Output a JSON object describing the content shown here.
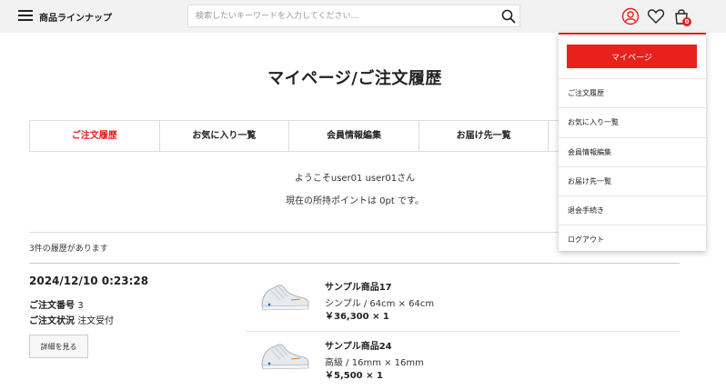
{
  "header": {
    "menu_label": "商品ラインナップ",
    "search_placeholder": "検索したいキーワードを入力してください...",
    "cart_count": "0",
    "accent": "#e8211c"
  },
  "icons": [
    "hamburger-icon",
    "search-icon",
    "user-icon",
    "heart-icon",
    "cart-icon"
  ],
  "page": {
    "title": "マイページ/ご注文履歴",
    "tabs": [
      {
        "label": "ご注文履歴",
        "active": true
      },
      {
        "label": "お気に入り一覧",
        "active": false
      },
      {
        "label": "会員情報編集",
        "active": false
      },
      {
        "label": "お届け先一覧",
        "active": false
      }
    ],
    "welcome": "ようこそuser01 user01さん",
    "points": "現在の所持ポイントは 0pt です。",
    "history_count": "3件の履歴があります"
  },
  "order": {
    "date": "2024/12/10 0:23:28",
    "number_label": "ご注文番号",
    "number": "3",
    "status_label": "ご注文状況",
    "status": "注文受付",
    "detail_button": "詳細を見る",
    "items": [
      {
        "name": "サンプル商品17",
        "variant": "シンプル / 64cm × 64cm",
        "price": "￥36,300 × 1"
      },
      {
        "name": "サンプル商品24",
        "variant": "高級 / 16mm × 16mm",
        "price": "￥5,500 × 1"
      }
    ]
  },
  "dropdown": {
    "mypage_button": "マイページ",
    "items": [
      "ご注文履歴",
      "お気に入り一覧",
      "会員情報編集",
      "お届け先一覧",
      "退会手続き",
      "ログアウト"
    ]
  }
}
